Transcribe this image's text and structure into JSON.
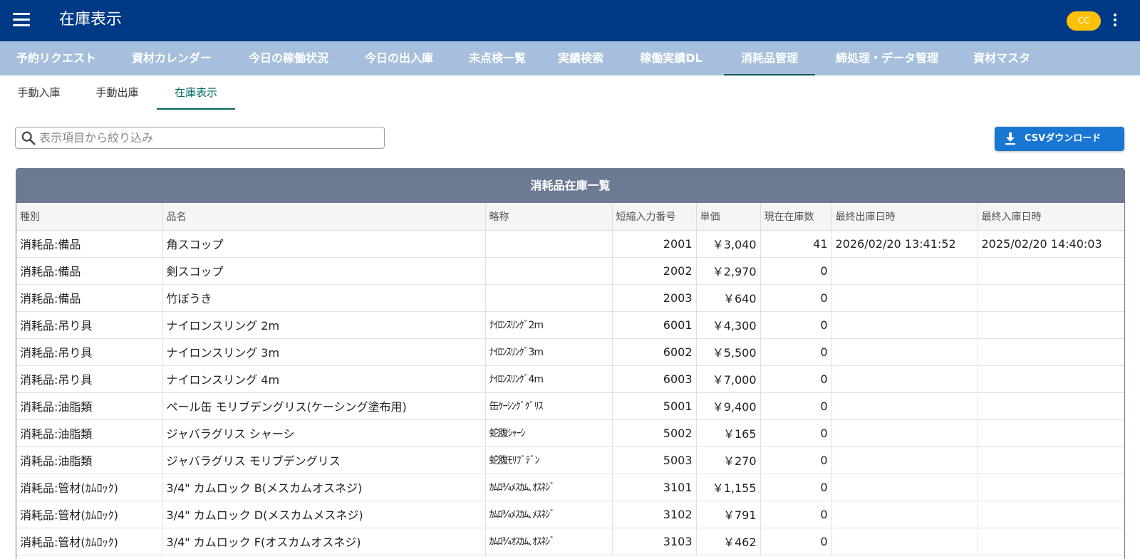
{
  "app": {
    "title": "在庫表示",
    "user_initials": "CC"
  },
  "main_tabs": [
    {
      "label": "予約リクエスト"
    },
    {
      "label": "資材カレンダー"
    },
    {
      "label": "今日の稼働状況"
    },
    {
      "label": "今日の出入庫"
    },
    {
      "label": "未点検一覧"
    },
    {
      "label": "実績検索"
    },
    {
      "label": "稼働実績DL"
    },
    {
      "label": "消耗品管理"
    },
    {
      "label": "締処理・データ管理"
    },
    {
      "label": "資材マスタ"
    }
  ],
  "active_main_tab": "消耗品管理",
  "sub_tabs": [
    {
      "label": "手動入庫"
    },
    {
      "label": "手動出庫"
    },
    {
      "label": "在庫表示"
    }
  ],
  "active_sub_tab": "在庫表示",
  "search": {
    "placeholder": "表示項目から絞り込み",
    "value": ""
  },
  "csv_button": {
    "label": "CSVダウンロード"
  },
  "table": {
    "caption": "消耗品在庫一覧",
    "columns": [
      "種別",
      "品名",
      "略称",
      "短縮入力番号",
      "単価",
      "現在在庫数",
      "最終出庫日時",
      "最終入庫日時"
    ],
    "rows": [
      [
        "消耗品:備品",
        "角スコップ",
        "",
        "2001",
        "￥3,040",
        "41",
        "2026/02/20 13:41:52",
        "2025/02/20 14:40:03"
      ],
      [
        "消耗品:備品",
        "剣スコップ",
        "",
        "2002",
        "￥2,970",
        "0",
        "",
        ""
      ],
      [
        "消耗品:備品",
        "竹ぼうき",
        "",
        "2003",
        "￥640",
        "0",
        "",
        ""
      ],
      [
        "消耗品:吊り具",
        "ナイロンスリング 2m",
        "ﾅｲﾛﾝｽﾘﾝｸﾞ2m",
        "6001",
        "￥4,300",
        "0",
        "",
        ""
      ],
      [
        "消耗品:吊り具",
        "ナイロンスリング 3m",
        "ﾅｲﾛﾝｽﾘﾝｸﾞ3m",
        "6002",
        "￥5,500",
        "0",
        "",
        ""
      ],
      [
        "消耗品:吊り具",
        "ナイロンスリング 4m",
        "ﾅｲﾛﾝｽﾘﾝｸﾞ4m",
        "6003",
        "￥7,000",
        "0",
        "",
        ""
      ],
      [
        "消耗品:油脂類",
        "ペール缶 モリブデングリス(ケーシング塗布用)",
        "缶ｹｰｼﾝｸﾞｸﾞﾘｽ",
        "5001",
        "￥9,400",
        "0",
        "",
        ""
      ],
      [
        "消耗品:油脂類",
        "ジャバラグリス シャーシ",
        "蛇腹ｼｬｰｼ",
        "5002",
        "￥165",
        "0",
        "",
        ""
      ],
      [
        "消耗品:油脂類",
        "ジャバラグリス モリブデングリス",
        "蛇腹ﾓﾘﾌﾞﾃﾞﾝ",
        "5003",
        "￥270",
        "0",
        "",
        ""
      ],
      [
        "消耗品:管材(ｶﾑﾛｯｸ)",
        "3/4\" カムロック B(メスカムオスネジ)",
        "ｶﾑﾛ¾ﾒｽｶﾑ､ｵｽﾈｼﾞ",
        "3101",
        "￥1,155",
        "0",
        "",
        ""
      ],
      [
        "消耗品:管材(ｶﾑﾛｯｸ)",
        "3/4\" カムロック D(メスカムメスネジ)",
        "ｶﾑﾛ¾ﾒｽｶﾑ､ﾒｽﾈｼﾞ",
        "3102",
        "￥791",
        "0",
        "",
        ""
      ],
      [
        "消耗品:管材(ｶﾑﾛｯｸ)",
        "3/4\" カムロック F(オスカムオスネジ)",
        "ｶﾑﾛ¾ｵｽｶﾑ､ｵｽﾈｼﾞ",
        "3103",
        "￥462",
        "0",
        "",
        ""
      ]
    ]
  }
}
